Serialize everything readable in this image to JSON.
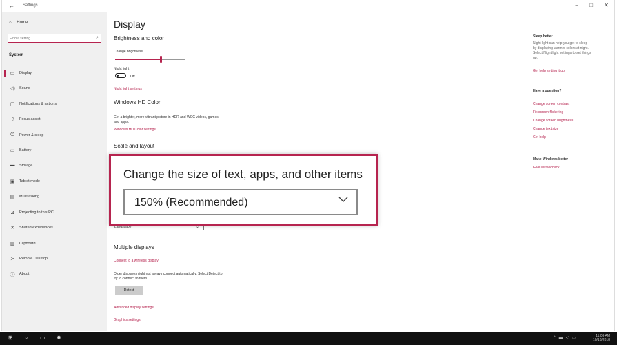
{
  "window": {
    "title": "Settings",
    "back_glyph": "←",
    "controls": {
      "minimize": "–",
      "maximize": "□",
      "close": "✕"
    }
  },
  "sidebar": {
    "home": {
      "label": "Home",
      "icon": "home-icon"
    },
    "search_placeholder": "Find a setting",
    "section_label": "System",
    "items": [
      {
        "label": "Display",
        "icon": "monitor-icon",
        "active": true
      },
      {
        "label": "Sound",
        "icon": "speaker-icon"
      },
      {
        "label": "Notifications & actions",
        "icon": "notifications-icon"
      },
      {
        "label": "Focus assist",
        "icon": "moon-icon"
      },
      {
        "label": "Power & sleep",
        "icon": "power-icon"
      },
      {
        "label": "Battery",
        "icon": "battery-icon"
      },
      {
        "label": "Storage",
        "icon": "storage-icon"
      },
      {
        "label": "Tablet mode",
        "icon": "tablet-icon"
      },
      {
        "label": "Multitasking",
        "icon": "multitasking-icon"
      },
      {
        "label": "Projecting to this PC",
        "icon": "projecting-icon"
      },
      {
        "label": "Shared experiences",
        "icon": "shared-icon"
      },
      {
        "label": "Clipboard",
        "icon": "clipboard-icon"
      },
      {
        "label": "Remote Desktop",
        "icon": "remote-desktop-icon"
      },
      {
        "label": "About",
        "icon": "info-icon"
      }
    ]
  },
  "main": {
    "title": "Display",
    "brightness_heading": "Brightness and color",
    "change_brightness_label": "Change brightness",
    "brightness_value": 0.65,
    "night_light_label": "Night light",
    "night_light_state": "Off",
    "night_light_settings_link": "Night light settings",
    "hd_color_heading": "Windows HD Color",
    "hd_color_desc_1": "Get a brighter, more vibrant picture in HDR and WCG videos, games,",
    "hd_color_desc_2": "and apps.",
    "hd_color_link": "Windows HD Color settings",
    "scale_heading": "Scale and layout",
    "orientation_value": "Landscape",
    "multiple_displays_heading": "Multiple displays",
    "wireless_link": "Connect to a wireless display",
    "detect_desc_1": "Older displays might not always connect automatically. Select Detect to",
    "detect_desc_2": "try to connect to them.",
    "detect_button": "Detect",
    "advanced_link": "Advanced display settings",
    "graphics_link": "Graphics settings"
  },
  "right": {
    "sleep_heading": "Sleep better",
    "sleep_desc": [
      "Night light can help you get to sleep",
      "by displaying warmer colors at night.",
      "Select Night light settings to set things",
      "up."
    ],
    "sleep_link": "Get help setting it up",
    "question_heading": "Have a question?",
    "question_links": [
      "Change screen contrast",
      "Fix screen flickering",
      "Change screen brightness",
      "Change text size",
      "Get help"
    ],
    "better_heading": "Make Windows better",
    "feedback_link": "Give us feedback"
  },
  "callout": {
    "title": "Change the size of text, apps, and other items",
    "value": "150% (Recommended)"
  },
  "taskbar": {
    "time": "11:09 AM",
    "date": "10/18/2018"
  },
  "colors": {
    "accent": "#b6244f",
    "sidebar_bg": "#f0f0f0",
    "taskbar_bg": "#111111"
  }
}
